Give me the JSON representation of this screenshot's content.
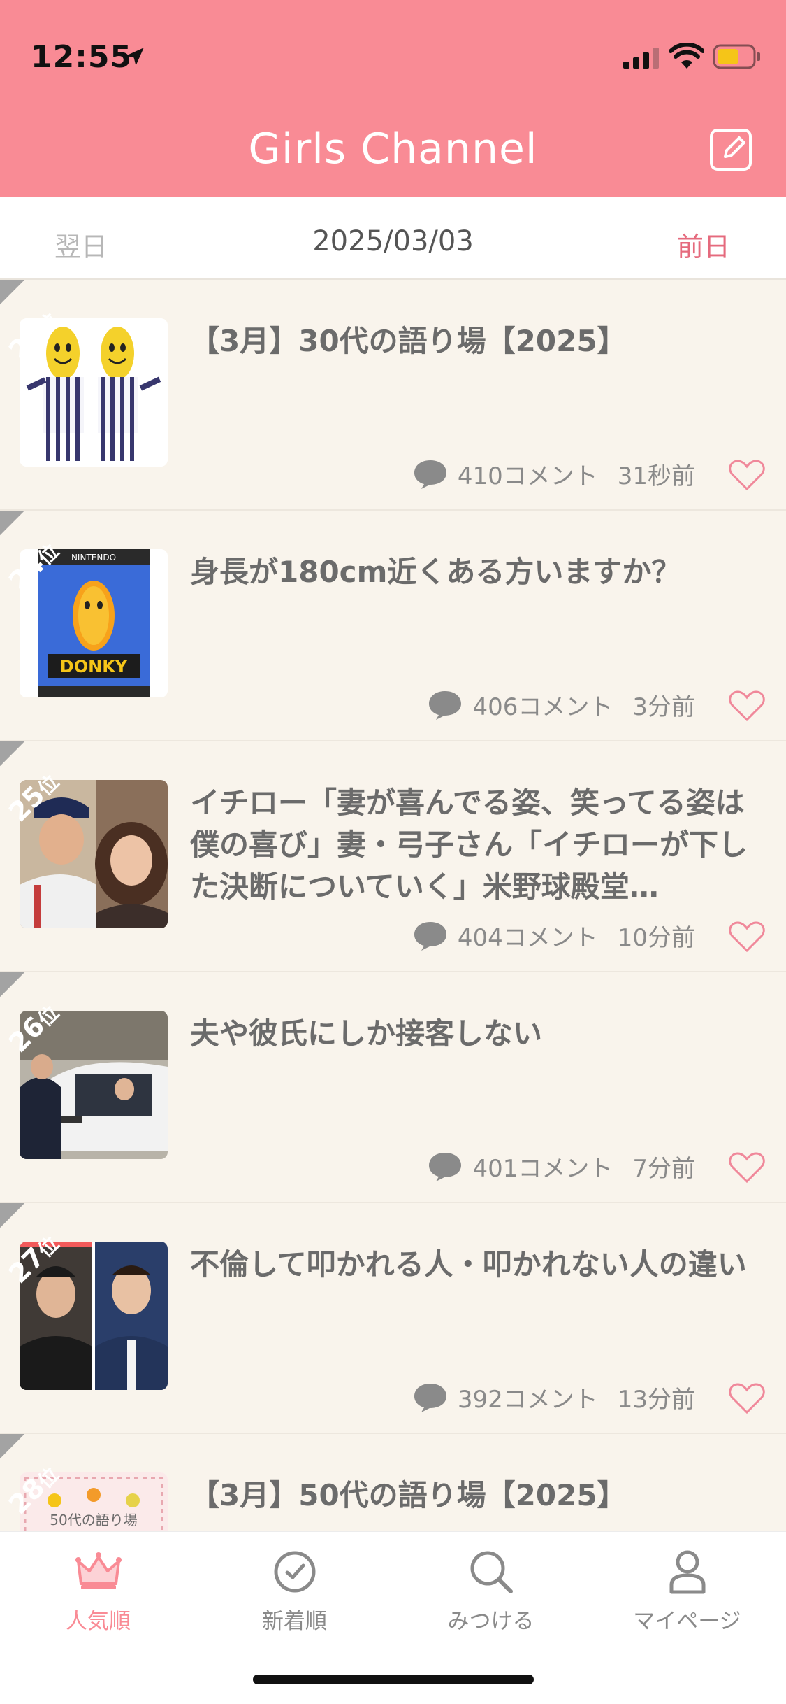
{
  "status": {
    "time": "12:55"
  },
  "header": {
    "title": "Girls Channel"
  },
  "datebar": {
    "next": "翌日",
    "current": "2025/03/03",
    "prev": "前日"
  },
  "topics": [
    {
      "rank_num": "23",
      "rank_suffix": "位",
      "title": "【3月】30代の語り場【2025】",
      "comments": "410コメント",
      "time": "31秒前"
    },
    {
      "rank_num": "24",
      "rank_suffix": "位",
      "title": "身長が180cm近くある方いますか？",
      "comments": "406コメント",
      "time": "3分前"
    },
    {
      "rank_num": "25",
      "rank_suffix": "位",
      "title": "イチロー「妻が喜んでる姿、笑ってる姿は僕の喜び」妻・弓子さん「イチローが下した決断についていく」米野球殿堂…",
      "comments": "404コメント",
      "time": "10分前"
    },
    {
      "rank_num": "26",
      "rank_suffix": "位",
      "title": "夫や彼氏にしか接客しない",
      "comments": "401コメント",
      "time": "7分前"
    },
    {
      "rank_num": "27",
      "rank_suffix": "位",
      "title": "不倫して叩かれる人・叩かれない人の違い",
      "comments": "392コメント",
      "time": "13分前"
    },
    {
      "rank_num": "28",
      "rank_suffix": "位",
      "title": "【3月】50代の語り場【2025】",
      "comments": "",
      "time": ""
    }
  ],
  "thumb6_text": "50代の語り場",
  "tabs": [
    {
      "label": "人気順",
      "icon": "crown-icon"
    },
    {
      "label": "新着順",
      "icon": "clock-icon"
    },
    {
      "label": "みつける",
      "icon": "search-icon"
    },
    {
      "label": "マイページ",
      "icon": "person-icon"
    }
  ],
  "colors": {
    "brand": "#f98b95",
    "background": "#f9f4ec",
    "accent_text": "#e56a7d"
  }
}
